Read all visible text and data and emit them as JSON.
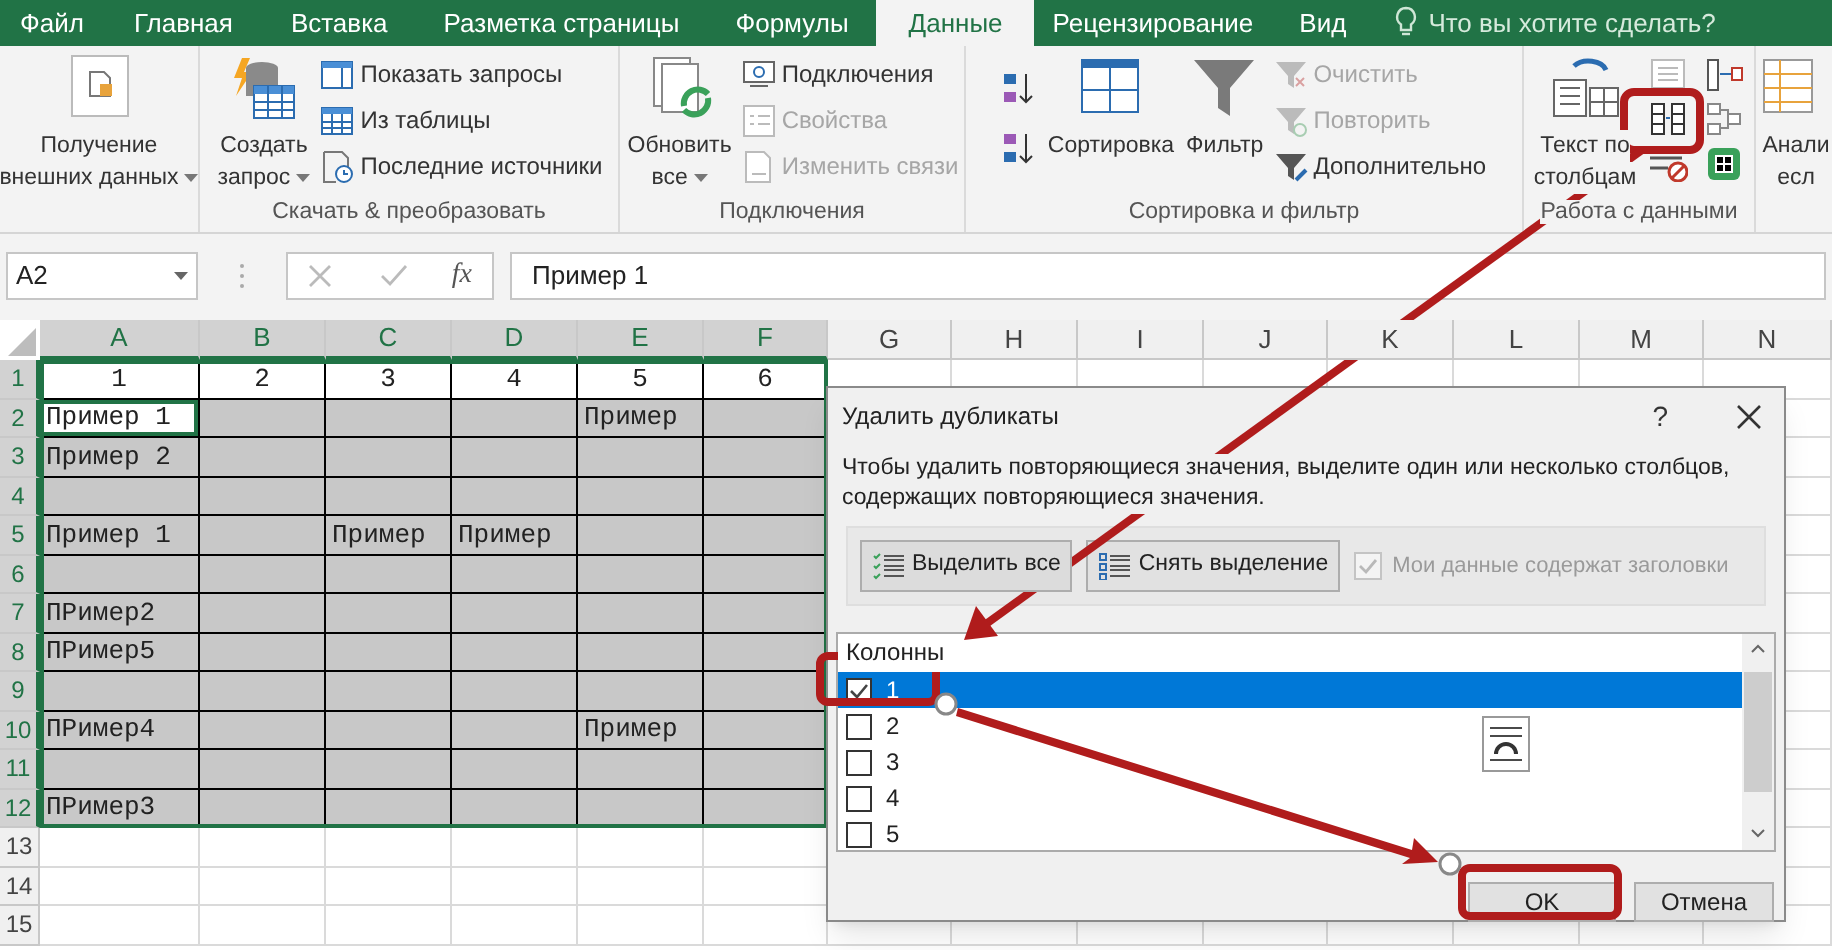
{
  "tabs": [
    {
      "label": "Файл",
      "selected": false
    },
    {
      "label": "Главная",
      "selected": false
    },
    {
      "label": "Вставка",
      "selected": false
    },
    {
      "label": "Разметка страницы",
      "selected": false
    },
    {
      "label": "Формулы",
      "selected": false
    },
    {
      "label": "Данные",
      "selected": true
    },
    {
      "label": "Рецензирование",
      "selected": false
    },
    {
      "label": "Вид",
      "selected": false
    }
  ],
  "search_hint": "Что вы хотите сделать?",
  "ribbon": {
    "groups": [
      {
        "items": [
          {
            "kind": "large",
            "lines": [
              "Получение",
              "внешних данных"
            ],
            "dropdown": true
          }
        ]
      },
      {
        "label": "Скачать & преобразовать",
        "items": [
          {
            "kind": "large",
            "lines": [
              "Создать",
              "запрос"
            ],
            "dropdown": true
          },
          {
            "kind": "stack",
            "entries": [
              {
                "label": "Показать запросы",
                "disabled": false
              },
              {
                "label": "Из таблицы",
                "disabled": false
              },
              {
                "label": "Последние источники",
                "disabled": false
              }
            ]
          }
        ]
      },
      {
        "label": "Подключения",
        "items": [
          {
            "kind": "large",
            "lines": [
              "Обновить",
              "все"
            ],
            "dropdown": true
          },
          {
            "kind": "stack",
            "entries": [
              {
                "label": "Подключения",
                "disabled": false
              },
              {
                "label": "Свойства",
                "disabled": true
              },
              {
                "label": "Изменить связи",
                "disabled": true
              }
            ]
          }
        ]
      },
      {
        "label": "Сортировка и фильтр",
        "items": [
          {
            "kind": "sort-icons"
          },
          {
            "kind": "large",
            "lines": [
              "Сортировка"
            ],
            "dropdown": false
          },
          {
            "kind": "large",
            "lines": [
              "Фильтр"
            ],
            "dropdown": false
          },
          {
            "kind": "stack",
            "entries": [
              {
                "label": "Очистить",
                "disabled": true
              },
              {
                "label": "Повторить",
                "disabled": true
              },
              {
                "label": "Дополнительно",
                "disabled": false
              }
            ]
          }
        ]
      },
      {
        "label": "Работа с данными",
        "items": [
          {
            "kind": "large",
            "lines": [
              "Текст по",
              "столбцам"
            ],
            "dropdown": false
          },
          {
            "kind": "tool-grid"
          }
        ]
      },
      {
        "items": [
          {
            "kind": "large",
            "lines": [
              "Анали",
              "есл"
            ],
            "dropdown": false
          }
        ]
      }
    ]
  },
  "formula_bar": {
    "name_box": "A2",
    "function_label": "fx",
    "formula": "Пример 1"
  },
  "sheet": {
    "columns": [
      {
        "label": "A",
        "selected": true
      },
      {
        "label": "B",
        "selected": true
      },
      {
        "label": "C",
        "selected": true
      },
      {
        "label": "D",
        "selected": true
      },
      {
        "label": "E",
        "selected": true
      },
      {
        "label": "F",
        "selected": true
      },
      {
        "label": "G",
        "selected": false
      },
      {
        "label": "H",
        "selected": false
      },
      {
        "label": "I",
        "selected": false
      },
      {
        "label": "J",
        "selected": false
      },
      {
        "label": "K",
        "selected": false
      },
      {
        "label": "L",
        "selected": false
      },
      {
        "label": "M",
        "selected": false
      },
      {
        "label": "N",
        "selected": false
      }
    ],
    "rows": [
      {
        "header": "1",
        "selected": true,
        "shaded": false,
        "cells": [
          {
            "text": "1",
            "active": false
          },
          {
            "text": "2",
            "active": false
          },
          {
            "text": "3",
            "active": false
          },
          {
            "text": "4",
            "active": false
          },
          {
            "text": "5",
            "active": false
          },
          {
            "text": "6",
            "active": false
          }
        ]
      },
      {
        "header": "2",
        "selected": true,
        "shaded": true,
        "cells": [
          {
            "text": "Пример 1",
            "active": true
          },
          null,
          null,
          null,
          {
            "text": "Пример",
            "active": false
          },
          null
        ]
      },
      {
        "header": "3",
        "selected": true,
        "shaded": true,
        "cells": [
          {
            "text": "Пример 2",
            "active": false
          },
          null,
          null,
          null,
          null,
          null
        ]
      },
      {
        "header": "4",
        "selected": true,
        "shaded": true,
        "cells": [
          null,
          null,
          null,
          null,
          null,
          null
        ]
      },
      {
        "header": "5",
        "selected": true,
        "shaded": true,
        "cells": [
          {
            "text": "Пример 1",
            "active": false
          },
          null,
          {
            "text": "Пример",
            "active": false
          },
          {
            "text": "Пример",
            "active": false
          },
          null,
          null
        ]
      },
      {
        "header": "6",
        "selected": true,
        "shaded": true,
        "cells": [
          null,
          null,
          null,
          null,
          null,
          null
        ]
      },
      {
        "header": "7",
        "selected": true,
        "shaded": true,
        "cells": [
          {
            "text": "ПРимер2",
            "active": false
          },
          null,
          null,
          null,
          null,
          null
        ]
      },
      {
        "header": "8",
        "selected": true,
        "shaded": true,
        "cells": [
          {
            "text": "ПРимер5",
            "active": false
          },
          null,
          null,
          null,
          null,
          null
        ]
      },
      {
        "header": "9",
        "selected": true,
        "shaded": true,
        "cells": [
          null,
          null,
          null,
          null,
          null,
          null
        ]
      },
      {
        "header": "10",
        "selected": true,
        "shaded": true,
        "cells": [
          {
            "text": "ПРимер4",
            "active": false
          },
          null,
          null,
          null,
          {
            "text": "Пример",
            "active": false
          },
          null
        ]
      },
      {
        "header": "11",
        "selected": true,
        "shaded": true,
        "cells": [
          null,
          null,
          null,
          null,
          null,
          null
        ]
      },
      {
        "header": "12",
        "selected": true,
        "shaded": true,
        "cells": [
          {
            "text": "ПРимер3",
            "active": false
          },
          null,
          null,
          null,
          null,
          null
        ]
      },
      {
        "header": "13",
        "selected": false,
        "shaded": false,
        "cells": []
      },
      {
        "header": "14",
        "selected": false,
        "shaded": false,
        "cells": []
      },
      {
        "header": "15",
        "selected": false,
        "shaded": false,
        "cells": []
      }
    ]
  },
  "dialog": {
    "title": "Удалить дубликаты",
    "help": "?",
    "description": "Чтобы удалить повторяющиеся значения, выделите один или несколько столбцов, содержащих повторяющиеся значения.",
    "select_all": "Выделить все",
    "unselect_all": "Снять выделение",
    "headers_checkbox": {
      "label": "Мои данные содержат заголовки",
      "checked": true,
      "disabled": true
    },
    "list": {
      "header": "Колонны",
      "items": [
        {
          "label": "1",
          "checked": true,
          "selected": true
        },
        {
          "label": "2",
          "checked": false,
          "selected": false
        },
        {
          "label": "3",
          "checked": false,
          "selected": false
        },
        {
          "label": "4",
          "checked": false,
          "selected": false
        },
        {
          "label": "5",
          "checked": false,
          "selected": false
        }
      ]
    },
    "ok": "OK",
    "cancel": "Отмена"
  }
}
